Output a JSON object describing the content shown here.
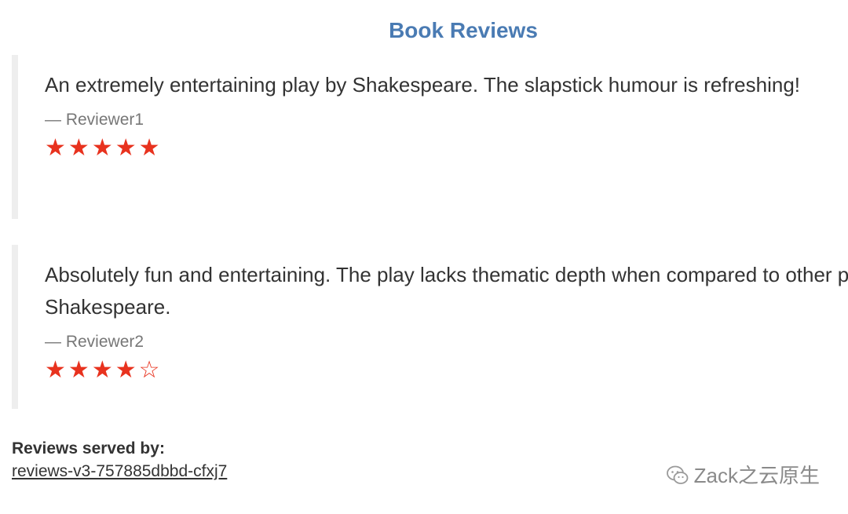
{
  "header": {
    "title": "Book Reviews"
  },
  "reviews": [
    {
      "text": "An extremely entertaining play by Shakespeare. The slapstick humour is refreshing!",
      "reviewer": "— Reviewer1",
      "rating": 5,
      "max_rating": 5,
      "star_color": "#e8321e"
    },
    {
      "text": "Absolutely fun and entertaining. The play lacks thematic depth when compared to other plays by Shakespeare.",
      "reviewer": "— Reviewer2",
      "rating": 4,
      "max_rating": 5,
      "star_color": "#e8321e"
    }
  ],
  "footer": {
    "served_label": "Reviews served by:",
    "served_host": "reviews-v3-757885dbbd-cfxj7"
  },
  "watermark": {
    "icon": "wechat-icon",
    "text": "Zack之云原生"
  },
  "colors": {
    "title": "#4a7bb3",
    "star": "#e8321e",
    "border": "#eeeeee"
  }
}
